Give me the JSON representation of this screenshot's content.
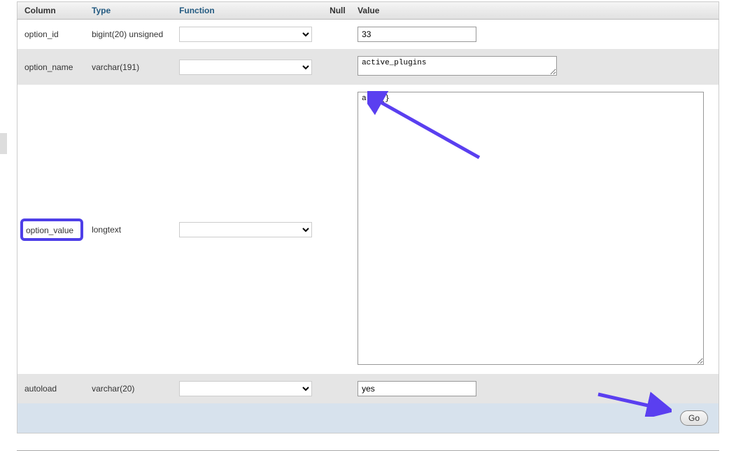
{
  "headers": {
    "column": "Column",
    "type": "Type",
    "function": "Function",
    "null": "Null",
    "value": "Value"
  },
  "rows": {
    "option_id": {
      "column": "option_id",
      "type": "bigint(20) unsigned",
      "value": "33"
    },
    "option_name": {
      "column": "option_name",
      "type": "varchar(191)",
      "value": "active_plugins"
    },
    "option_value": {
      "column": "option_value",
      "type": "longtext",
      "value": "a:0:{}"
    },
    "autoload": {
      "column": "autoload",
      "type": "varchar(20)",
      "value": "yes"
    }
  },
  "buttons": {
    "go": "Go"
  },
  "annotation": {
    "arrow_color": "#5a3ff0"
  }
}
